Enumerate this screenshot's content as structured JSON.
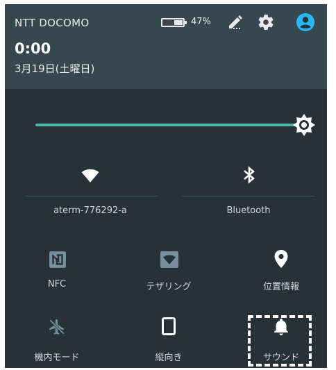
{
  "status": {
    "carrier": "NTT DOCOMO",
    "battery_percent": "47%",
    "battery_level": 0.47,
    "icons": [
      "battery-icon",
      "edit-icon",
      "settings-icon",
      "account-icon"
    ]
  },
  "header": {
    "time": "0:00",
    "date": "3月19日(土曜日)"
  },
  "brightness": {
    "level": 1.0,
    "icon": "brightness-icon"
  },
  "tiles": {
    "wifi": {
      "label": "aterm-776292-a",
      "icon": "wifi-icon",
      "active": true
    },
    "bluetooth": {
      "label": "Bluetooth",
      "icon": "bluetooth-icon",
      "active": true
    },
    "nfc": {
      "label": "NFC",
      "icon": "nfc-icon",
      "active": false
    },
    "tethering": {
      "label": "テザリング",
      "icon": "hotspot-icon",
      "active": false
    },
    "location": {
      "label": "位置情報",
      "icon": "location-icon",
      "active": true
    },
    "airplane": {
      "label": "機内モード",
      "icon": "airplane-icon",
      "active": false
    },
    "rotation": {
      "label": "縦向き",
      "icon": "portrait-icon",
      "active": true
    },
    "sound": {
      "label": "サウンド",
      "icon": "bell-icon",
      "active": true
    }
  },
  "colors": {
    "panel": "#263238",
    "header": "#37474f",
    "accent": "#4db6ac",
    "account": "#29b6f6",
    "inactive_icon": "#78909c"
  }
}
